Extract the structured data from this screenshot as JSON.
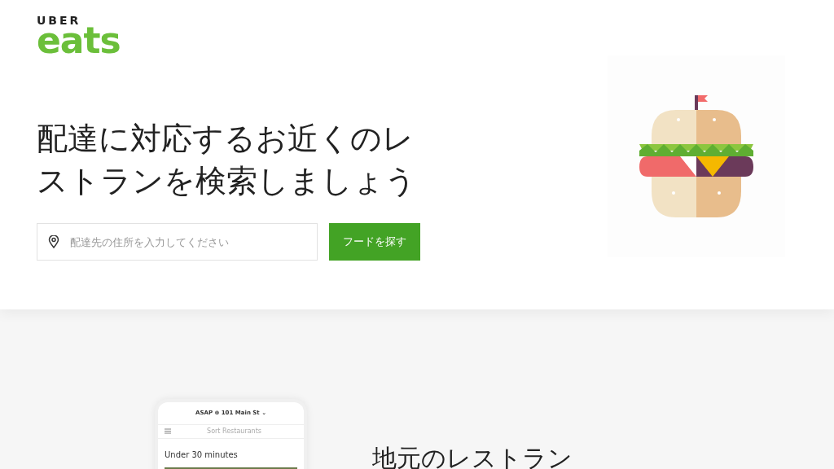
{
  "logo": {
    "top": "UBER",
    "bottom": "eats"
  },
  "hero": {
    "heading": "配達に対応するお近くのレストランを検索しましょう",
    "address_field": {
      "placeholder": "配達先の住所を入力してください"
    },
    "button": "フードを探す"
  },
  "phone": {
    "delivery": "ASAP ⊕ 101 Main St ⌄",
    "sort": "Sort Restaurants",
    "section": "Under 30 minutes"
  },
  "feature": {
    "heading": "地元のレストラン"
  }
}
